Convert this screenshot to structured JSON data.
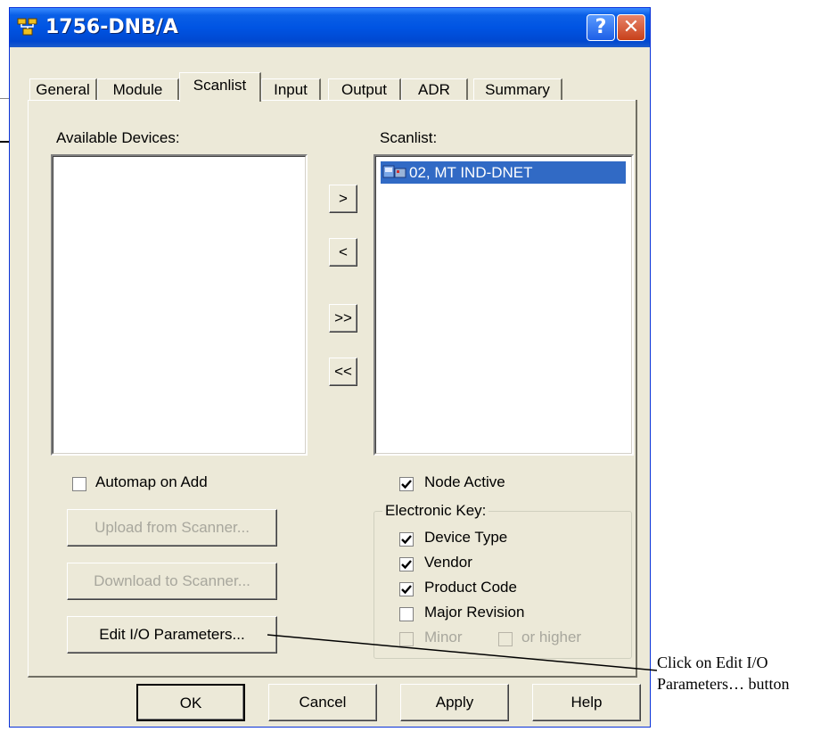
{
  "window": {
    "title": "1756-DNB/A",
    "help_glyph": "?",
    "close_glyph": "✕"
  },
  "tabs": [
    {
      "label": "General"
    },
    {
      "label": "Module"
    },
    {
      "label": "Scanlist",
      "active": true
    },
    {
      "label": "Input"
    },
    {
      "label": "Output"
    },
    {
      "label": "ADR"
    },
    {
      "label": "Summary"
    }
  ],
  "available": {
    "label": "Available Devices:",
    "items": []
  },
  "transfer_buttons": {
    "add": ">",
    "remove": "<",
    "add_all": ">>",
    "remove_all": "<<"
  },
  "scanlist": {
    "label": "Scanlist:",
    "items": [
      {
        "text": "02, MT IND-DNET",
        "selected": true
      }
    ]
  },
  "automap": {
    "label": "Automap on Add",
    "checked": false
  },
  "left_buttons": {
    "upload": "Upload from Scanner...",
    "download": "Download to Scanner...",
    "edit_io": "Edit I/O Parameters..."
  },
  "node_active": {
    "label": "Node Active",
    "checked": true
  },
  "electronic_key": {
    "title": "Electronic Key:",
    "device_type": {
      "label": "Device Type",
      "checked": true
    },
    "vendor": {
      "label": "Vendor",
      "checked": true
    },
    "product_code": {
      "label": "Product Code",
      "checked": true
    },
    "major_revision": {
      "label": "Major Revision",
      "checked": false
    },
    "minor": {
      "label": "Minor",
      "checked": false,
      "enabled": false
    },
    "or_higher": {
      "label": "or higher",
      "checked": false,
      "enabled": false
    }
  },
  "footer": {
    "ok": "OK",
    "cancel": "Cancel",
    "apply": "Apply",
    "help": "Help"
  },
  "callout": {
    "line1": "Click on Edit I/O",
    "line2": "Parameters… button"
  },
  "colors": {
    "titlebar": "#0054e3",
    "dialog_bg": "#ece9d8",
    "selection": "#316ac5"
  }
}
